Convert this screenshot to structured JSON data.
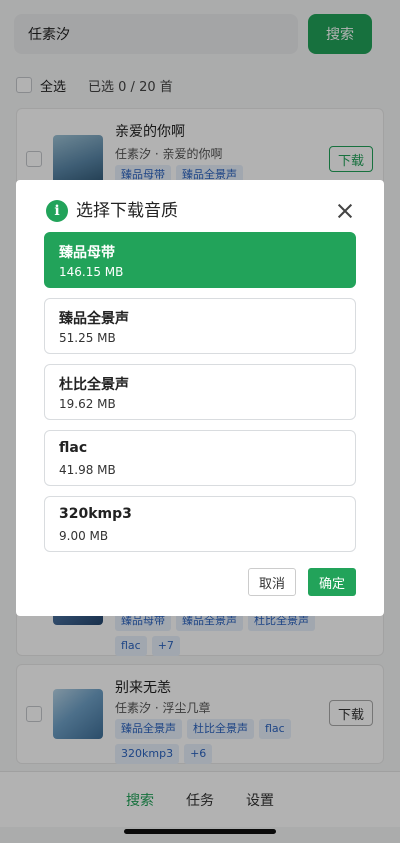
{
  "search": {
    "query": "任素汐",
    "button_label": "搜索"
  },
  "selection": {
    "select_all_label": "全选",
    "selected_count": "已选 0 / 20 首"
  },
  "songs": [
    {
      "title": "亲爱的你啊",
      "subtitle": "任素汐 · 亲爱的你啊",
      "tags": [
        "臻品母带",
        "臻品全景声"
      ],
      "download_label": "下载"
    },
    {
      "title": "",
      "subtitle": "",
      "tags": [
        "臻品母带",
        "臻品全景声",
        "杜比全景声",
        "flac",
        "+7"
      ],
      "download_label": ""
    },
    {
      "title": "别来无恙",
      "subtitle": "任素汐 · 浮尘几章",
      "tags": [
        "臻品全景声",
        "杜比全景声",
        "flac",
        "320kmp3",
        "+6"
      ],
      "download_label": "下载"
    }
  ],
  "nav": {
    "items": [
      "搜索",
      "任务",
      "设置"
    ],
    "active": "搜索"
  },
  "dialog": {
    "title": "选择下载音质",
    "options": [
      {
        "name": "臻品母带",
        "size": "146.15 MB",
        "selected": true
      },
      {
        "name": "臻品全景声",
        "size": "51.25 MB",
        "selected": false
      },
      {
        "name": "杜比全景声",
        "size": "19.62 MB",
        "selected": false
      },
      {
        "name": "flac",
        "size": "41.98 MB",
        "selected": false
      },
      {
        "name": "320kmp3",
        "size": "9.00 MB",
        "selected": false
      }
    ],
    "cancel_label": "取消",
    "confirm_label": "确定"
  },
  "colors": {
    "accent": "#22a35a",
    "tag_bg": "#e7f0fb",
    "tag_text": "#2c64c0"
  }
}
